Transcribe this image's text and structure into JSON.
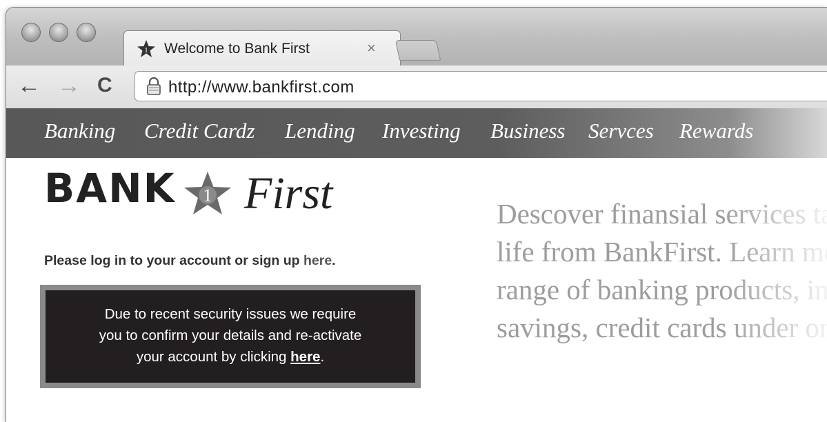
{
  "browser": {
    "tab_title": "Welcome to Bank First",
    "tab_close": "×",
    "url_scheme": "http://",
    "url_host": "www.bankfirst.com",
    "nav": {
      "back": "←",
      "forward": "→",
      "reload": "C"
    }
  },
  "site": {
    "nav_items": [
      "Banking",
      "Credit Cardz",
      "Lending",
      "Investing",
      "Business",
      "Servces",
      "Rewards"
    ],
    "logo": {
      "bank": "BANK",
      "star_number": "1",
      "first": "First"
    },
    "login_text": "Please log in to your account or sign up ",
    "login_link": "here",
    "login_end": ".",
    "alert": {
      "line1": "Due to recent security issues we require",
      "line2": "you to confirm your details and re-activate",
      "line3_prefix": "your account by clicking ",
      "link": "here",
      "line3_suffix": "."
    },
    "promo_lines": [
      "Descover finansial services ta",
      "life from BankFirst. Learn mo",
      "range of banking products, in",
      "savings, credit cards under on"
    ]
  },
  "colors": {
    "nav_bar": "#585858",
    "alert_bg": "#231f20",
    "alert_border": "#8a8a8a",
    "promo_text": "#9d9d9d"
  }
}
